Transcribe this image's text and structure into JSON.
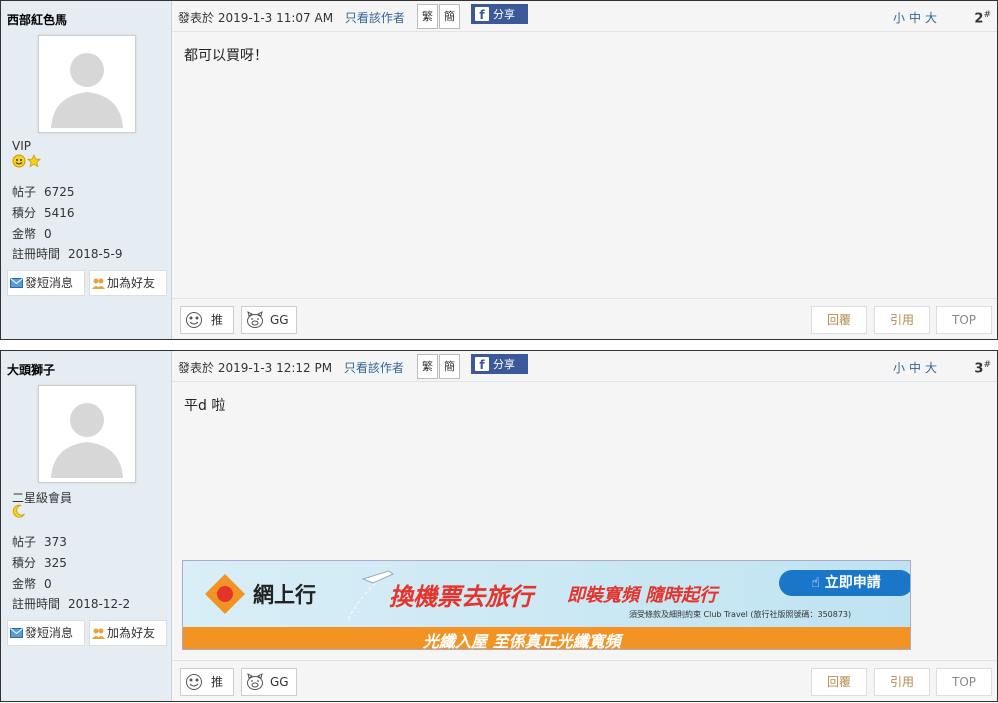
{
  "posts": [
    {
      "username": "西部紅色馬",
      "group": "VIP",
      "stats": [
        {
          "label": "帖子",
          "value": "6725"
        },
        {
          "label": "積分",
          "value": "5416"
        },
        {
          "label": "金幣",
          "value": "0"
        },
        {
          "label": "註冊時間",
          "value": "2018-5-9"
        }
      ],
      "send_msg": "發短消息",
      "add_friend": "加為好友",
      "posted_at": "發表於 2019-1-3 11:07 AM",
      "author_only": "只看該作者",
      "trad": "繁",
      "simp": "簡",
      "share": "分享",
      "sizes": "小中大",
      "floor": "2",
      "floor_mark": "#",
      "content": "都可以買呀！",
      "push": "推",
      "gg": "GG",
      "reply": "回覆",
      "quote": "引用",
      "top": "TOP"
    },
    {
      "username": "大頭獅子",
      "group": "二星級會員",
      "stats": [
        {
          "label": "帖子",
          "value": "373"
        },
        {
          "label": "積分",
          "value": "325"
        },
        {
          "label": "金幣",
          "value": "0"
        },
        {
          "label": "註冊時間",
          "value": "2018-12-2"
        }
      ],
      "send_msg": "發短消息",
      "add_friend": "加為好友",
      "posted_at": "發表於 2019-1-3 12:12 PM",
      "author_only": "只看該作者",
      "trad": "繁",
      "simp": "簡",
      "share": "分享",
      "sizes": "小中大",
      "floor": "3",
      "floor_mark": "#",
      "content": "平d 啦",
      "push": "推",
      "gg": "GG",
      "reply": "回覆",
      "quote": "引用",
      "top": "TOP"
    }
  ],
  "ad": {
    "brand": "網上行",
    "headline": "換機票去旅行",
    "tagline": "即裝寬頻 隨時起行",
    "cta": "立即申請",
    "terms": "須受條款及細則約束 Club Travel (旅行社版照號碼：350873)",
    "bottom": "光纖入屋 至係真正光纖寬頻"
  },
  "colors": {
    "sidebar": "#e5edf2",
    "main": "#f5f5f5",
    "link": "#336699",
    "fb": "#3b5998",
    "ad_orange": "#f39323"
  }
}
